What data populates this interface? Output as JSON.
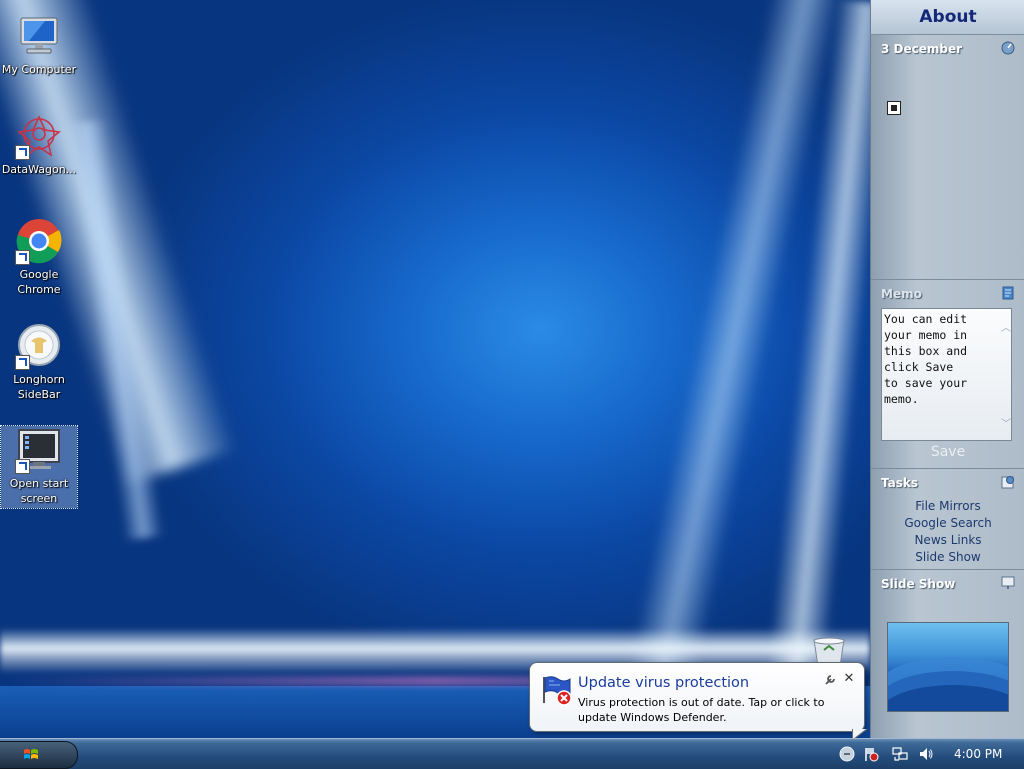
{
  "desktop": {
    "icons": [
      {
        "label": "My Computer"
      },
      {
        "label": "DataWagon..."
      },
      {
        "label": "Google Chrome"
      },
      {
        "label": "Longhorn SideBar"
      },
      {
        "label": "Open start screen"
      }
    ]
  },
  "sidebar": {
    "about": "About",
    "clock": {
      "date": "3 December"
    },
    "memo": {
      "title": "Memo",
      "text": "You can edit\nyour memo in\nthis box and\nclick Save\nto save your\nmemo.",
      "save_label": "Save"
    },
    "tasks": {
      "title": "Tasks",
      "items": [
        "File Mirrors",
        "Google Search",
        "News Links",
        "Slide Show"
      ]
    },
    "slideshow": {
      "title": "Slide Show"
    }
  },
  "balloon": {
    "title": "Update virus protection",
    "text": "Virus protection is out of date. Tap or click to update Windows Defender.",
    "close_glyph": "✕"
  },
  "taskbar": {
    "clock": "4:00 PM",
    "tray_icons": [
      "action-center-icon",
      "windows-defender-icon",
      "network-icon",
      "volume-icon"
    ]
  },
  "colors": {
    "sidebar_title": "#14287a",
    "balloon_title": "#1a3c9c",
    "wallpaper_center": "#2a8be6"
  }
}
